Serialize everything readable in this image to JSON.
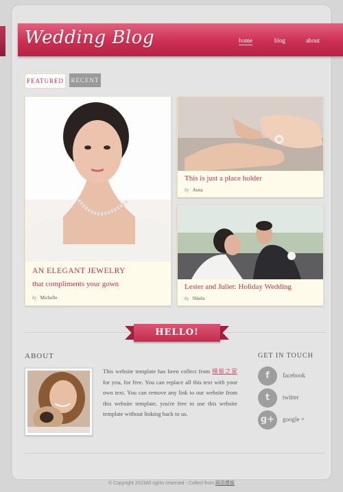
{
  "header": {
    "logo": "Wedding Blog",
    "nav": [
      {
        "label": "home",
        "active": true
      },
      {
        "label": "blog",
        "active": false
      },
      {
        "label": "about",
        "active": false
      }
    ]
  },
  "tabs": {
    "featured": "FEATURED",
    "recent": "RECENT"
  },
  "posts": [
    {
      "title_line1": "AN ELEGANT JEWELRY",
      "title_line2": "that compliments your gown",
      "by_label": "by",
      "author": "Michelle"
    },
    {
      "title": "This is just a place holder",
      "by_label": "by",
      "author": "Anna"
    },
    {
      "title": "Lester and Juliet: Holiday Wedding",
      "by_label": "by",
      "author": "Shiela"
    }
  ],
  "banner": {
    "text": "HELLO!"
  },
  "about": {
    "heading": "ABOUT",
    "text_before_link": "This website template has been collect from ",
    "link_text": "模板之家",
    "text_after_link": " for you, for free. You can replace all this text with your own text. You can remove any link to our website from this website template, you're free to use this website template without linking back to us."
  },
  "contact": {
    "heading": "GET IN TOUCH",
    "items": [
      {
        "icon": "facebook-icon",
        "glyph": "f",
        "label": "facebook"
      },
      {
        "icon": "twitter-icon",
        "glyph": "t",
        "label": "twitter"
      },
      {
        "icon": "googleplus-icon",
        "glyph": "g+",
        "label": "google +"
      }
    ]
  },
  "footer": {
    "text": "© Copyright 2023All rights reserved - Collect from ",
    "link": "网页模板"
  },
  "colors": {
    "accent": "#c8304f",
    "cream": "#fffbea",
    "background": "#d6d6d6"
  }
}
